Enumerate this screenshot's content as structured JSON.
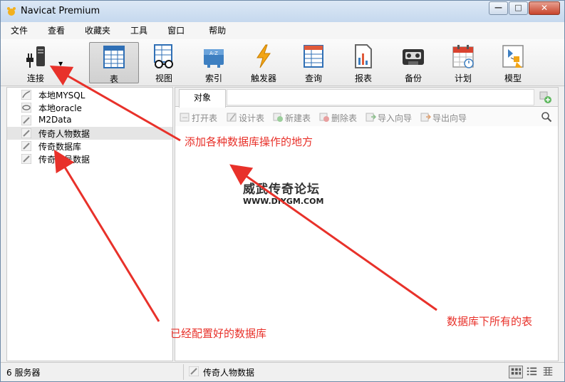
{
  "window": {
    "title": "Navicat Premium",
    "minimize_glyph": "—",
    "maximize_glyph": "□",
    "close_glyph": "✕"
  },
  "menu": {
    "items": [
      "文件",
      "查看",
      "收藏夹",
      "工具",
      "窗口",
      "帮助"
    ]
  },
  "toolbar": {
    "connect": "连接",
    "table": "表",
    "view": "视图",
    "index": "索引",
    "trigger": "触发器",
    "query": "查询",
    "report": "报表",
    "backup": "备份",
    "schedule": "计划",
    "model": "模型",
    "index_icon_text": "A-Z"
  },
  "connections": [
    {
      "label": "本地MYSQL",
      "icon": "mysql-icon"
    },
    {
      "label": "本地oracle",
      "icon": "oracle-icon"
    },
    {
      "label": "M2Data",
      "icon": "sqlite-icon"
    },
    {
      "label": "传奇人物数据",
      "icon": "sqlite-icon",
      "selected": true
    },
    {
      "label": "传奇数据库",
      "icon": "sqlite-icon"
    },
    {
      "label": "传奇账号数据",
      "icon": "sqlite-icon"
    }
  ],
  "objects_panel": {
    "tab_label": "对象",
    "actions": [
      "打开表",
      "设计表",
      "新建表",
      "删除表",
      "导入向导",
      "导出向导"
    ]
  },
  "watermark": {
    "logo": "威武传奇论坛",
    "url": "WWW.DIYGM.COM"
  },
  "annotations": {
    "toolbar_note": "添加各种数据库操作的地方",
    "connections_note": "已经配置好的数据库",
    "tables_note": "数据库下所有的表"
  },
  "status": {
    "server_count": "6 服务器",
    "current_db": "传奇人物数据"
  },
  "colors": {
    "annotation": "#e8312a",
    "lightning": "#f2a516",
    "calendar": "#d9432f"
  }
}
